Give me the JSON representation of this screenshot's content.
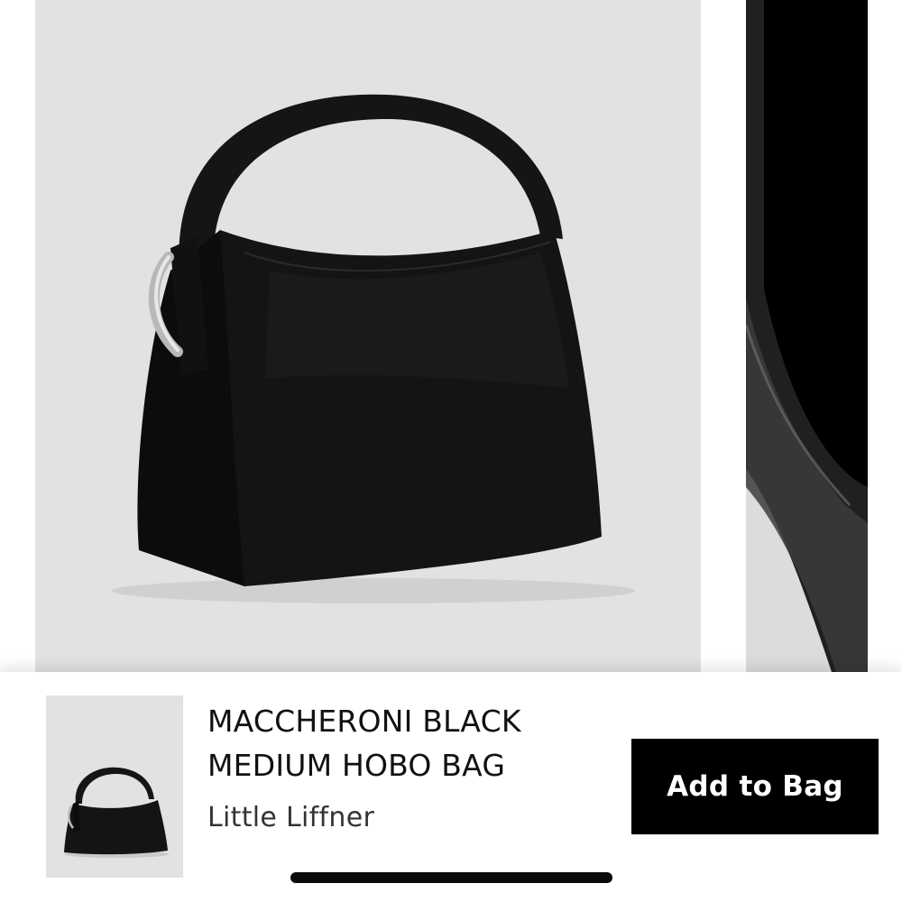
{
  "gallery": {
    "images": [
      {
        "icon": "handbag-photo",
        "alt": ""
      },
      {
        "icon": "handbag-detail-photo",
        "alt": ""
      }
    ]
  },
  "product": {
    "title_line1": "MACCHERONI BLACK",
    "title_line2": "MEDIUM HOBO BAG",
    "brand": "Little Liffner",
    "thumbnail_icon": "handbag-thumbnail"
  },
  "actions": {
    "add_to_bag_label": "Add to Bag"
  },
  "colors": {
    "image_bg": "#e2e2e2",
    "button_bg": "#000000",
    "button_text": "#ffffff"
  }
}
